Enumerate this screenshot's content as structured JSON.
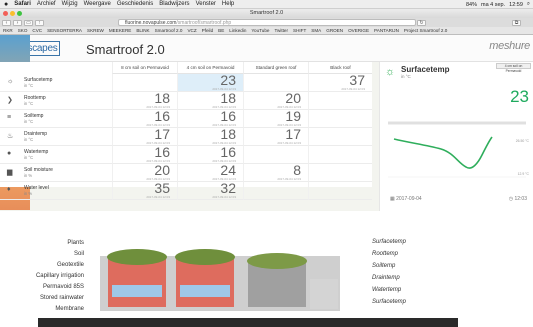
{
  "menubar": {
    "apple": "",
    "items": [
      "Safari",
      "Archief",
      "Wijzig",
      "Weergave",
      "Geschiedenis",
      "Bladwijzers",
      "Venster",
      "Help"
    ],
    "status": [
      "84%",
      "ma 4 sep.",
      "12:59"
    ]
  },
  "window": {
    "title": "Smartroof 2.0"
  },
  "url": {
    "host": "fluorine.novapulse.com",
    "path": "/smartroof/smartroof.php"
  },
  "bookmarks": [
    "RKR",
    "SKO",
    "CVC",
    "SENSORTERRA",
    "SKREW",
    "MEEKERE",
    "BLINK",
    "Smartroof 2.0",
    "VCZ",
    "Pfeild",
    "BE",
    "Linkedin",
    "YouTube",
    "Twitter",
    "SHIFT",
    "SMA",
    "GROEN",
    "OVERIGE",
    "PANTARIJN",
    "Project Smartroof 2.0"
  ],
  "page": {
    "logo": "Rootscapes",
    "title": "Smartroof 2.0",
    "brand": "meshure"
  },
  "table": {
    "columns": [
      "8 cm soil on Permavoid",
      "4 cm soil on Permavoid",
      "Standard green roof",
      "Black roof"
    ],
    "rows": [
      {
        "name": "Surfacetemp",
        "unit": "in °C",
        "icon": "sun-icon",
        "values": [
          "",
          "23",
          "",
          "37"
        ],
        "dates": [
          "",
          "2017-09-04 12:03",
          "",
          "2017-09-04 12:03"
        ]
      },
      {
        "name": "Roottemp",
        "unit": "in °C",
        "icon": "chevron-icon",
        "values": [
          "18",
          "18",
          "20",
          ""
        ],
        "dates": [
          "2017-09-04 12:03",
          "2017-09-04 12:03",
          "2017-09-04 12:03",
          ""
        ]
      },
      {
        "name": "Soiltemp",
        "unit": "in °C",
        "icon": "layers-icon",
        "values": [
          "16",
          "16",
          "19",
          ""
        ],
        "dates": [
          "2017-09-04 12:03",
          "2017-09-04 12:03",
          "2017-09-04 12:03",
          ""
        ]
      },
      {
        "name": "Draintemp",
        "unit": "in °C",
        "icon": "drain-icon",
        "values": [
          "17",
          "18",
          "17",
          ""
        ],
        "dates": [
          "2017-09-04 12:03",
          "2017-09-04 12:03",
          "2017-09-04 12:03",
          ""
        ]
      },
      {
        "name": "Watertemp",
        "unit": "in °C",
        "icon": "drop-icon",
        "values": [
          "16",
          "16",
          "",
          ""
        ],
        "dates": [
          "2017-09-04 12:03",
          "2017-09-04 12:03",
          "",
          ""
        ]
      },
      {
        "name": "Soil moisture",
        "unit": "in %",
        "icon": "soil-icon",
        "values": [
          "20",
          "24",
          "8",
          ""
        ],
        "dates": [
          "2017-09-04 12:03",
          "2017-09-04 12:03",
          "2017-09-04 12:03",
          ""
        ]
      },
      {
        "name": "Water level",
        "unit": "in %",
        "icon": "water-level-icon",
        "values": [
          "35",
          "32",
          "",
          ""
        ],
        "dates": [
          "2017-09-04 12:03",
          "2017-09-04 12:03",
          "",
          ""
        ]
      }
    ]
  },
  "panel": {
    "title": "Surfacetemp",
    "unit": "in °C",
    "badge": "4 cm soil on Permavoid",
    "value": "23",
    "label_high": "26.50 °C",
    "label_low": "12.9 °C",
    "date": "2017-09-04",
    "time": "12:03"
  },
  "diagram": {
    "left_labels": [
      "Plants",
      "Soil",
      "Geotextile",
      "Capillary irrigation",
      "Permavoid 85S",
      "Stored rainwater",
      "Membrane"
    ],
    "right_labels": [
      "Surfacetemp",
      "Roottemp",
      "Soiltemp",
      "Draintemp",
      "Watertemp",
      "Surfacetemp"
    ]
  }
}
